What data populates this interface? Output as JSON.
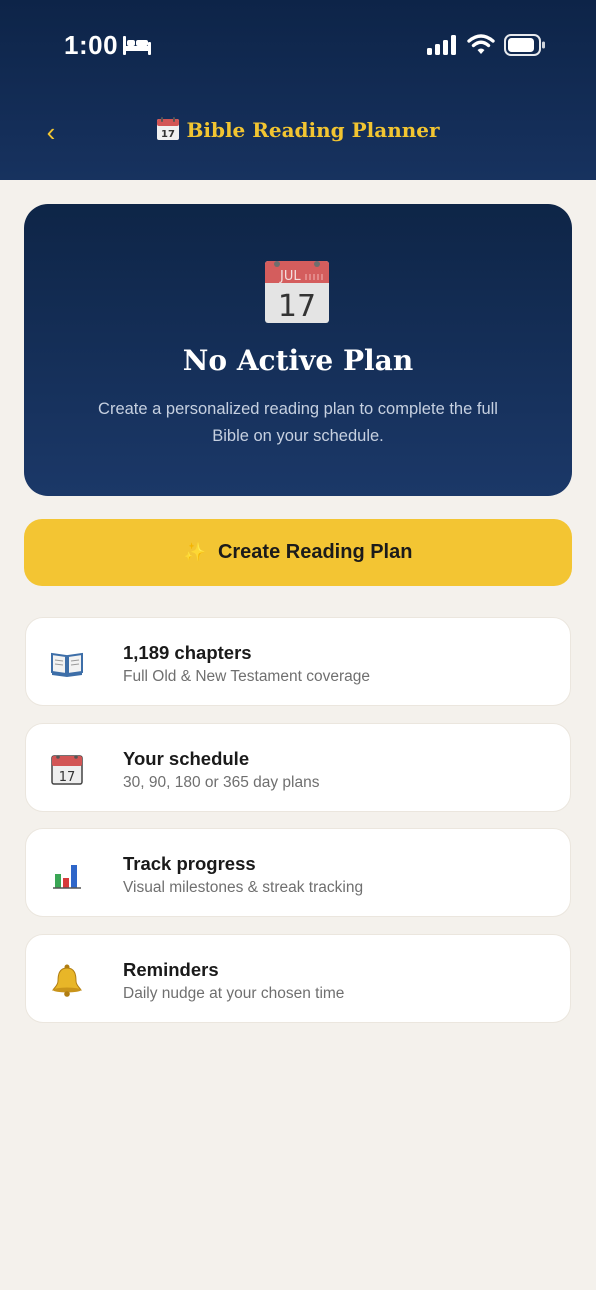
{
  "status_bar": {
    "time": "1:00"
  },
  "nav": {
    "back_label": "‹",
    "title": "Bible Reading Planner"
  },
  "hero": {
    "calendar_month": "JUL",
    "calendar_day": "17",
    "title": "No Active Plan",
    "subtitle": "Create a personalized reading plan to complete the full Bible on your schedule."
  },
  "create_button": {
    "sparkle": "✨",
    "label": "Create Reading Plan"
  },
  "features": [
    {
      "icon": "book-icon",
      "title": "1,189 chapters",
      "desc": "Full Old & New Testament coverage"
    },
    {
      "icon": "calendar-icon",
      "title": "Your schedule",
      "desc": "30, 90, 180 or 365 day plans"
    },
    {
      "icon": "bar-chart-icon",
      "title": "Track progress",
      "desc": "Visual milestones & streak tracking"
    },
    {
      "icon": "bell-icon",
      "title": "Reminders",
      "desc": "Daily nudge at your chosen time"
    }
  ],
  "colors": {
    "header_bg": "#0d2448",
    "accent_gold": "#f3c533",
    "page_bg": "#f4f1ec"
  }
}
